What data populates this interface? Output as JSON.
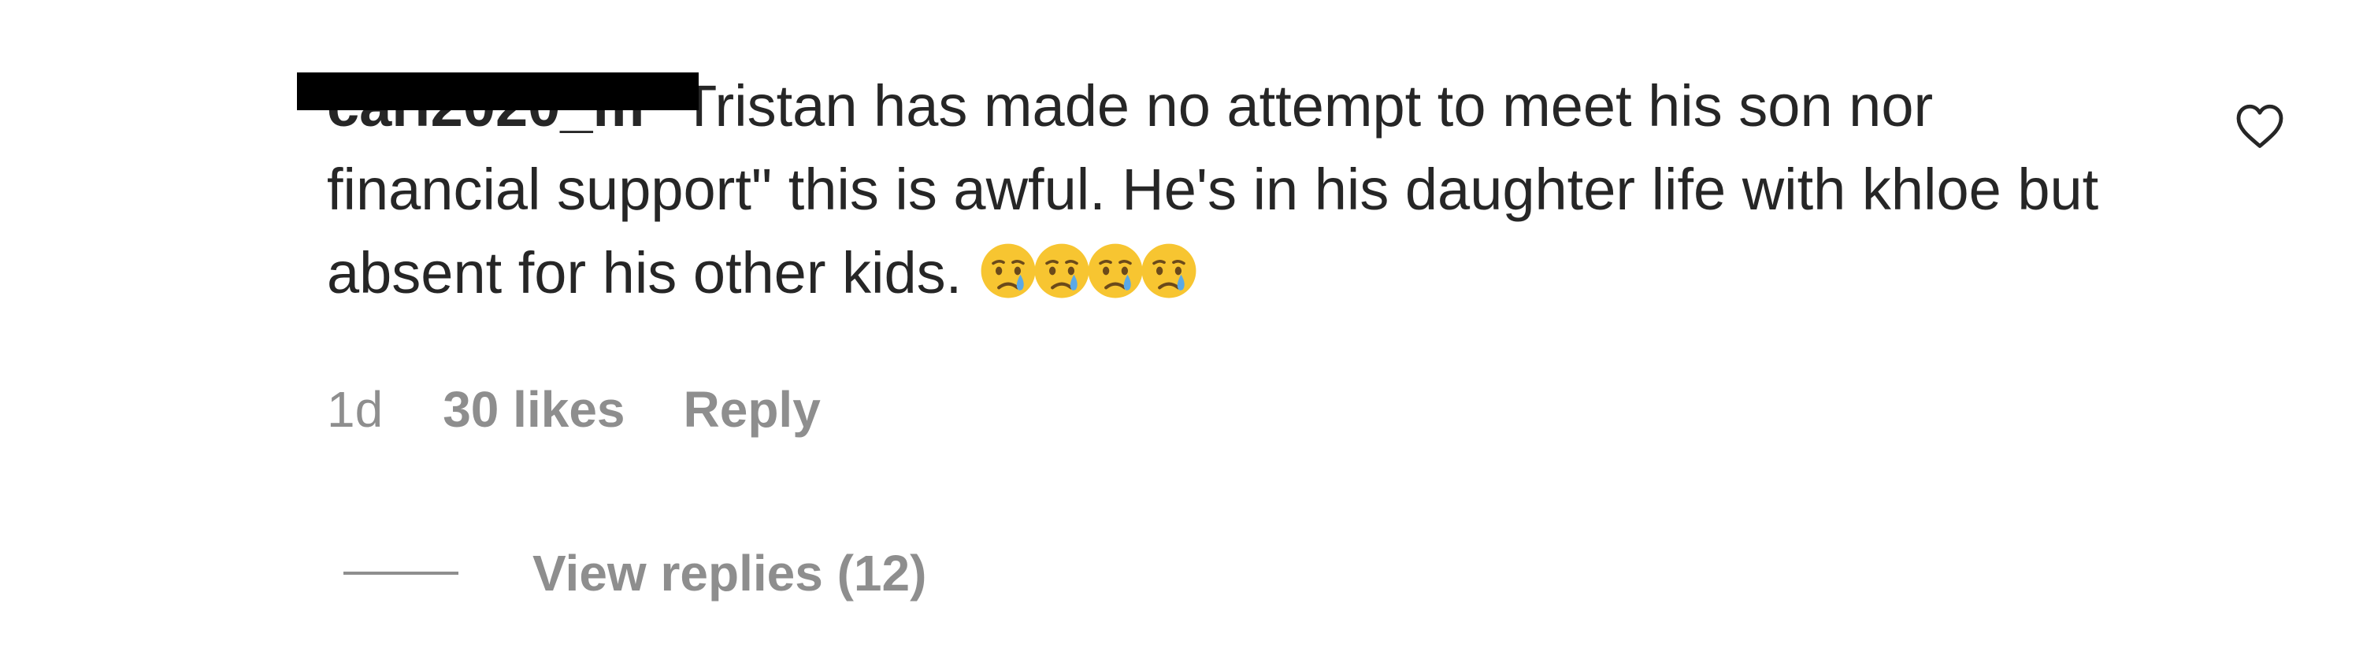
{
  "comment": {
    "username": "cari2020_m",
    "text": " \"Tristan has made no attempt to meet his son nor financial support\" this is awful. He's in his daughter life with khloe but absent for his other kids. ",
    "emojis": [
      "crying-face",
      "crying-face",
      "crying-face",
      "crying-face"
    ],
    "time": "1d",
    "likes": "30 likes",
    "reply_label": "Reply",
    "view_replies_label": "View replies (12)",
    "like_icon": "heart-outline-icon",
    "colors": {
      "text": "#262626",
      "meta": "#8e8e8e",
      "redaction": "#000000",
      "emoji_face": "#f7c531",
      "emoji_tear": "#5aa9e6"
    }
  }
}
